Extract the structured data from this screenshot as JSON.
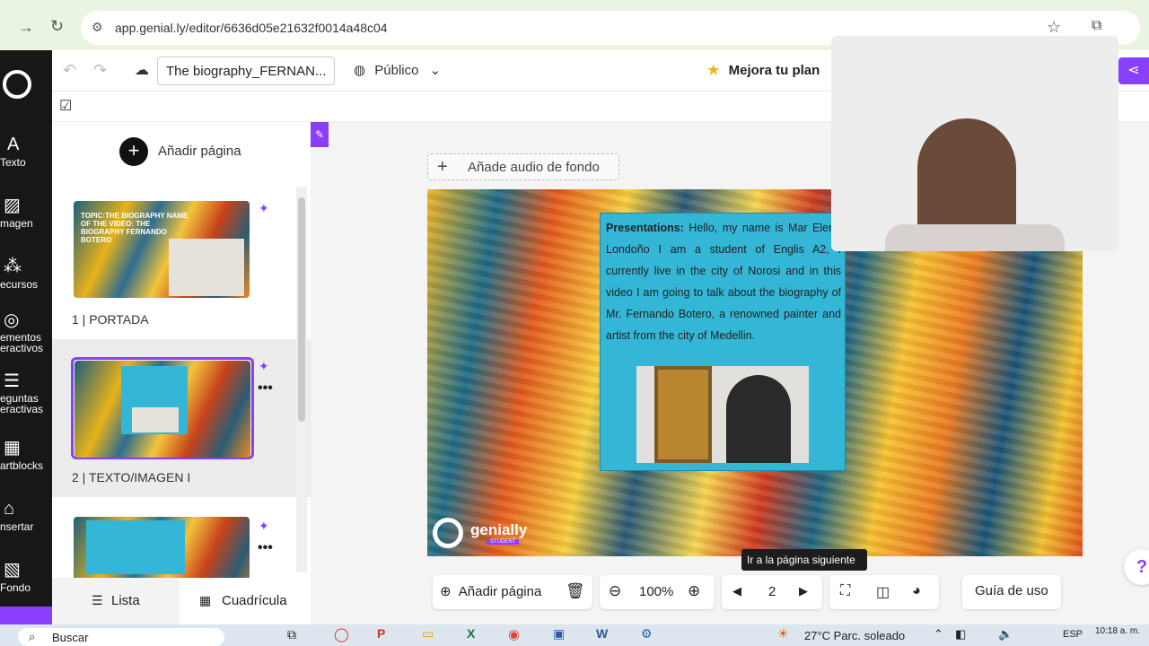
{
  "browser": {
    "url": "app.genial.ly/editor/6636d05e21632f0014a48c04"
  },
  "editor": {
    "title": "The biography_FERNAN...",
    "visibility": "Público",
    "upgrade": "Mejora tu plan"
  },
  "left_toolbar": [
    {
      "icon": "text-icon",
      "label": "Texto"
    },
    {
      "icon": "image-icon",
      "label": "magen"
    },
    {
      "icon": "resources-icon",
      "label": "ecursos"
    },
    {
      "icon": "interactive-icon",
      "label": "ementos\neractivos"
    },
    {
      "icon": "questions-icon",
      "label": "eguntas\neractivas"
    },
    {
      "icon": "smartblocks-icon",
      "label": "artblocks"
    },
    {
      "icon": "insert-icon",
      "label": "nsertar"
    },
    {
      "icon": "background-icon",
      "label": "Fondo"
    }
  ],
  "pages_panel": {
    "add_page": "Añadir página",
    "pages": [
      {
        "label": "1 |  PORTADA",
        "thumb_text": "TOPIC:THE BIOGRAPHY NAME OF THE VIDEO: THE BIOGRAPHY FERNANDO BOTERO"
      },
      {
        "label": "2 |  TEXTO/IMAGEN I"
      },
      {
        "label": ""
      }
    ],
    "view_list": "Lista",
    "view_grid": "Cuadrícula"
  },
  "canvas": {
    "add_audio": "Añade audio de fondo",
    "slide_text_bold": "Presentations:",
    "slide_text": " Hello, my name is Mar Elena Londoño I am a student of Englis A2, I currently live in the city of Norosi and in this video I am going to talk about the biography of Mr. Fernando Botero, a renowned painter and artist from the city of Medellin.",
    "logo": "genially",
    "logo_badge": "STUDENT"
  },
  "bottom_toolbar": {
    "add_page": "Añadir página",
    "zoom": "100%",
    "page_number": "2",
    "tooltip": "Ir a la página siguiente",
    "guide": "Guía de uso"
  },
  "taskbar": {
    "search": "Buscar",
    "weather": "27°C  Parc. soleado",
    "lang": "ESP",
    "time": "10:18 a. m."
  },
  "colors": {
    "accent": "#8a3ffc",
    "slide_box": "#34b6d6",
    "chrome": "#e9f4e3"
  }
}
